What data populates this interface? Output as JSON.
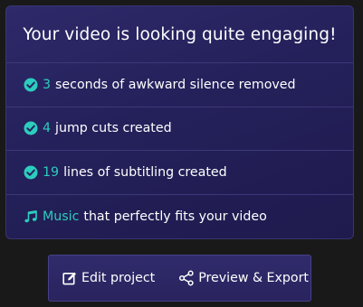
{
  "card": {
    "title": "Your video is looking quite engaging!",
    "items": [
      {
        "icon": "check-circle-icon",
        "highlight": "3",
        "text": "seconds of awkward silence removed"
      },
      {
        "icon": "check-circle-icon",
        "highlight": "4",
        "text": "jump cuts created"
      },
      {
        "icon": "check-circle-icon",
        "highlight": "19",
        "text": "lines of subtitling created"
      },
      {
        "icon": "music-note-icon",
        "highlight": "Music",
        "text": "that perfectly fits your video"
      }
    ]
  },
  "actions": {
    "edit_label": "Edit project",
    "edit_icon": "edit-icon",
    "preview_label": "Preview & Export",
    "preview_icon": "share-icon"
  },
  "colors": {
    "accent": "#2ccdbd",
    "card_bg": "#27235f",
    "page_bg": "#191919"
  }
}
